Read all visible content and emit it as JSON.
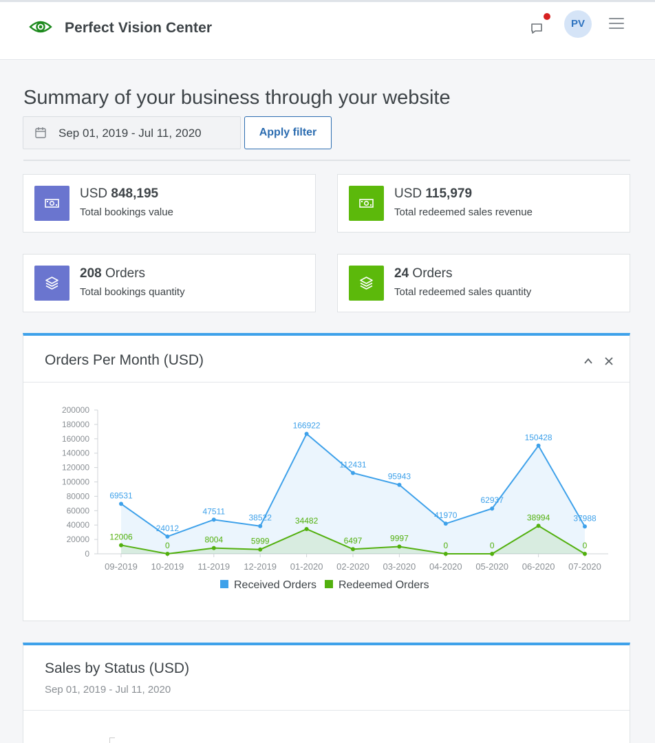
{
  "header": {
    "brand_name": "Perfect Vision Center",
    "avatar_initials": "PV",
    "brand_color": "#1e8a1e",
    "notification_color": "#d62020"
  },
  "page": {
    "title": "Summary of your business through your website"
  },
  "filter": {
    "date_range": "Sep 01, 2019 - Jul 11, 2020",
    "apply_label": "Apply filter"
  },
  "stats": [
    {
      "prefix": "USD",
      "value": "848,195",
      "suffix": "",
      "label": "Total bookings value",
      "icon": "money-icon",
      "color": "#6a75cf"
    },
    {
      "prefix": "USD",
      "value": "115,979",
      "suffix": "",
      "label": "Total redeemed sales revenue",
      "icon": "money-icon",
      "color": "#5cb90b"
    },
    {
      "prefix": "",
      "value": "208",
      "suffix": "Orders",
      "label": "Total bookings quantity",
      "icon": "layers-icon",
      "color": "#6a75cf"
    },
    {
      "prefix": "",
      "value": "24",
      "suffix": "Orders",
      "label": "Total redeemed sales quantity",
      "icon": "layers-icon",
      "color": "#5cb90b"
    }
  ],
  "orders_panel": {
    "title": "Orders Per Month (USD)"
  },
  "sales_panel": {
    "title": "Sales by Status (USD)",
    "subtitle": "Sep 01, 2019 - Jul 11, 2020"
  },
  "chart_data": {
    "type": "line",
    "title": "Orders Per Month (USD)",
    "categories": [
      "09-2019",
      "10-2019",
      "11-2019",
      "12-2019",
      "01-2020",
      "02-2020",
      "03-2020",
      "04-2020",
      "05-2020",
      "06-2020",
      "07-2020"
    ],
    "ylim": [
      0,
      200000
    ],
    "yticks": [
      0,
      20000,
      40000,
      60000,
      80000,
      100000,
      120000,
      140000,
      160000,
      180000,
      200000
    ],
    "series": [
      {
        "name": "Received Orders",
        "color": "#3ea1ea",
        "values": [
          69531,
          24012,
          47511,
          38522,
          166922,
          112431,
          95943,
          41970,
          62937,
          150428,
          37988
        ]
      },
      {
        "name": "Redeemed Orders",
        "color": "#52b00e",
        "values": [
          12006,
          0,
          8004,
          5999,
          34482,
          6497,
          9997,
          0,
          0,
          38994,
          0
        ]
      }
    ],
    "legend": "bottom-center",
    "grid": false
  }
}
